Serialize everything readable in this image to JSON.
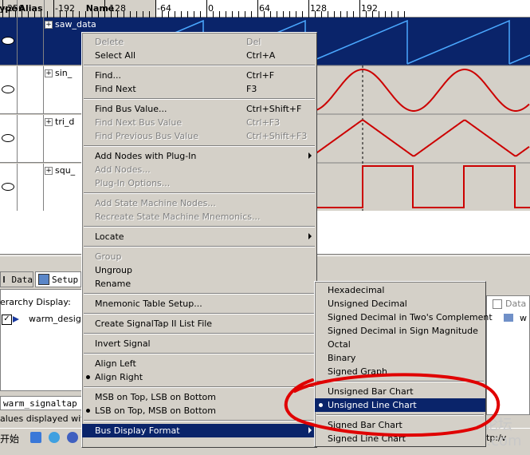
{
  "columns": {
    "type": "ype",
    "alias": "Alias",
    "name": "Name"
  },
  "time_ticks": [
    "-256",
    "-192",
    "-128",
    "-64",
    "0",
    "64",
    "128",
    "192"
  ],
  "signals": [
    {
      "name": "saw_data",
      "selected": true
    },
    {
      "name": "sin_"
    },
    {
      "name": "tri_d"
    },
    {
      "name": "squ_"
    }
  ],
  "left_panel": {
    "tab_data": "Data",
    "tab_setup": "Setup",
    "hierarchy_label": "erarchy Display:",
    "tree_item": "warm_design",
    "instance": "warm_signaltap",
    "values_text": "alues displayed with",
    "start_text": "开始"
  },
  "right_panel": {
    "label": "Data",
    "item": "w",
    "field": "tp:/v"
  },
  "watermark": {
    "line1": "51黑电子论坛",
    "line2": "51hei.com"
  },
  "context_menu": {
    "items": [
      {
        "label": "Delete",
        "shortcut": "Del",
        "disabled": true
      },
      {
        "label": "Select All",
        "shortcut": "Ctrl+A"
      },
      {
        "sep": true
      },
      {
        "label": "Find...",
        "shortcut": "Ctrl+F"
      },
      {
        "label": "Find Next",
        "shortcut": "F3"
      },
      {
        "sep": true
      },
      {
        "label": "Find Bus Value...",
        "shortcut": "Ctrl+Shift+F"
      },
      {
        "label": "Find Next Bus Value",
        "shortcut": "Ctrl+F3",
        "disabled": true
      },
      {
        "label": "Find Previous Bus Value",
        "shortcut": "Ctrl+Shift+F3",
        "disabled": true
      },
      {
        "sep": true
      },
      {
        "label": "Add Nodes with Plug-In",
        "submenu": true
      },
      {
        "label": "Add Nodes...",
        "disabled": true
      },
      {
        "label": "Plug-In Options...",
        "disabled": true
      },
      {
        "sep": true
      },
      {
        "label": "Add State Machine Nodes...",
        "disabled": true
      },
      {
        "label": "Recreate State Machine Mnemonics...",
        "disabled": true
      },
      {
        "sep": true
      },
      {
        "label": "Locate",
        "submenu": true
      },
      {
        "sep": true
      },
      {
        "label": "Group",
        "disabled": true
      },
      {
        "label": "Ungroup"
      },
      {
        "label": "Rename"
      },
      {
        "sep": true
      },
      {
        "label": "Mnemonic Table Setup..."
      },
      {
        "sep": true
      },
      {
        "label": "Create SignalTap II List File"
      },
      {
        "sep": true
      },
      {
        "label": "Invert Signal"
      },
      {
        "sep": true
      },
      {
        "label": "Align Left"
      },
      {
        "label": "Align Right",
        "checked": true
      },
      {
        "sep": true
      },
      {
        "label": "MSB on Top, LSB on Bottom"
      },
      {
        "label": "LSB on Top, MSB on Bottom",
        "checked": true
      },
      {
        "sep": true
      },
      {
        "label": "Bus Display Format",
        "submenu": true,
        "highlighted": true
      }
    ]
  },
  "format_submenu": {
    "items": [
      {
        "label": "Hexadecimal"
      },
      {
        "label": "Unsigned Decimal"
      },
      {
        "label": "Signed Decimal in Two's Complement"
      },
      {
        "label": "Signed Decimal in Sign Magnitude"
      },
      {
        "label": "Octal"
      },
      {
        "label": "Binary"
      },
      {
        "label": "Signed Graph"
      },
      {
        "sep": true
      },
      {
        "label": "Unsigned Bar Chart"
      },
      {
        "label": "Unsigned Line Chart",
        "checked": true,
        "highlighted": true
      },
      {
        "sep": true
      },
      {
        "label": "Signed Bar Chart"
      },
      {
        "label": "Signed Line Chart"
      }
    ]
  },
  "colors": {
    "wave": "#cc0000",
    "selection": "#0a246a",
    "annotation": "#e00000",
    "saw": "#4aa8ff"
  }
}
